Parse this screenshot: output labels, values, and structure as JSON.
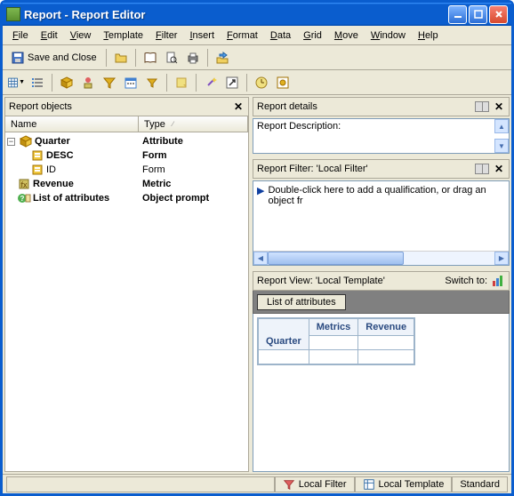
{
  "window": {
    "title": "Report - Report Editor"
  },
  "menubar": [
    "File",
    "Edit",
    "View",
    "Template",
    "Filter",
    "Insert",
    "Format",
    "Data",
    "Grid",
    "Move",
    "Window",
    "Help"
  ],
  "toolbar1": {
    "save_and_close": "Save and Close"
  },
  "left_pane": {
    "title": "Report objects",
    "columns": {
      "name": "Name",
      "type": "Type"
    },
    "rows": [
      {
        "name": "Quarter",
        "type": "Attribute",
        "icon": "cube-icon",
        "bold": true,
        "indent": 0,
        "expander": "-"
      },
      {
        "name": "DESC",
        "type": "Form",
        "icon": "form-icon",
        "bold": true,
        "indent": 1,
        "expander": ""
      },
      {
        "name": "ID",
        "type": "Form",
        "icon": "form-icon",
        "bold": false,
        "indent": 1,
        "expander": ""
      },
      {
        "name": "Revenue",
        "type": "Metric",
        "icon": "metric-icon",
        "bold": true,
        "indent": 0,
        "expander": ""
      },
      {
        "name": "List of attributes",
        "type": "Object prompt",
        "icon": "prompt-icon",
        "bold": true,
        "indent": 0,
        "expander": ""
      }
    ]
  },
  "details": {
    "title": "Report details",
    "description_label": "Report Description:"
  },
  "filter": {
    "title": "Report Filter: 'Local Filter'",
    "hint": "Double-click here to add a qualification, or drag an object fr"
  },
  "view": {
    "title": "Report View: 'Local Template'",
    "switch_to": "Switch to:",
    "chip": "List of attributes",
    "grid": {
      "row_label": "Quarter",
      "metrics_label": "Metrics",
      "columns": [
        "Revenue"
      ]
    }
  },
  "status": {
    "local_filter": "Local Filter",
    "local_template": "Local Template",
    "standard": "Standard"
  }
}
